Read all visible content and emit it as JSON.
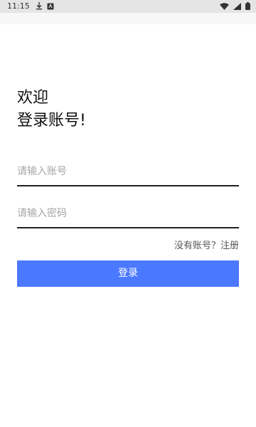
{
  "status_bar": {
    "time": "11:15",
    "left_icons": [
      "download-icon",
      "notification-app-icon"
    ],
    "right_icons": [
      "wifi-icon",
      "signal-icon",
      "battery-icon"
    ]
  },
  "welcome": {
    "line1": "欢迎",
    "line2": "登录账号!"
  },
  "form": {
    "account_placeholder": "请输入账号",
    "password_placeholder": "请输入密码",
    "register_link": "没有账号？注册",
    "login_label": "登录"
  },
  "colors": {
    "accent": "#4a78ff",
    "status_bar_bg": "#e5e5e5",
    "underline": "#222222"
  }
}
